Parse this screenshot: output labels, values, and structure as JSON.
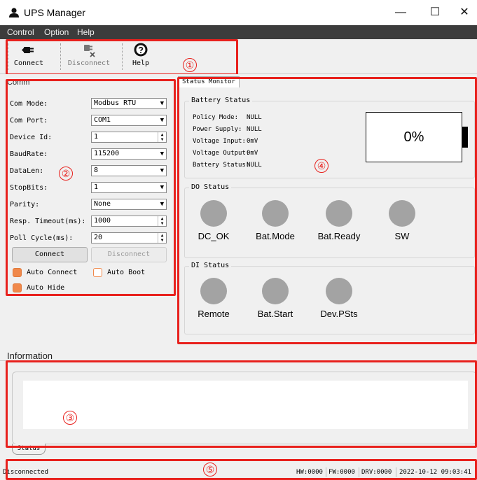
{
  "window": {
    "title": "UPS Manager",
    "minimize": "—",
    "maximize": "☐",
    "close": "✕"
  },
  "menu": [
    "Control",
    "Option",
    "Help"
  ],
  "toolbar": {
    "connect": "Connect",
    "disconnect": "Disconnect",
    "help": "Help"
  },
  "callouts": [
    "①",
    "②",
    "③",
    "④",
    "⑤"
  ],
  "comm": {
    "title": "Comm",
    "fields": [
      {
        "label": "Com Mode:",
        "value": "Modbus RTU",
        "control": "dropdown"
      },
      {
        "label": "Com Port:",
        "value": "COM1",
        "control": "dropdown"
      },
      {
        "label": "Device Id:",
        "value": "1",
        "control": "spinner"
      },
      {
        "label": "BaudRate:",
        "value": "115200",
        "control": "dropdown"
      },
      {
        "label": "DataLen:",
        "value": "8",
        "control": "dropdown"
      },
      {
        "label": "StopBits:",
        "value": "1",
        "control": "dropdown"
      },
      {
        "label": "Parity:",
        "value": "None",
        "control": "dropdown"
      },
      {
        "label": "Resp. Timeout(ms):",
        "value": "1000",
        "control": "spinner"
      },
      {
        "label": "Poll Cycle(ms):",
        "value": "20",
        "control": "spinner"
      }
    ],
    "connect_btn": "Connect",
    "disconnect_btn": "Disconnect",
    "auto_connect": {
      "label": "Auto Connect",
      "checked": true
    },
    "auto_boot": {
      "label": "Auto Boot",
      "checked": false
    },
    "auto_hide": {
      "label": "Auto Hide",
      "checked": true
    }
  },
  "status_monitor": {
    "tab": "Status Monitor",
    "battery_status": {
      "title": "Battery Status",
      "rows": [
        {
          "label": "Policy Mode:",
          "value": "NULL"
        },
        {
          "label": "Power Supply:",
          "value": "NULL"
        },
        {
          "label": "Voltage Input:",
          "value": "0mV"
        },
        {
          "label": "Voltage Output:",
          "value": "0mV"
        },
        {
          "label": "Battery Status:",
          "value": "NULL"
        }
      ],
      "percent": "0%"
    },
    "do_status": {
      "title": "DO Status",
      "leds": [
        "DC_OK",
        "Bat.Mode",
        "Bat.Ready",
        "SW"
      ]
    },
    "di_status": {
      "title": "DI Status",
      "leds": [
        "Remote",
        "Bat.Start",
        "Dev.PSts"
      ]
    },
    "led_color": "#a3a3a3"
  },
  "information": {
    "title": "Information",
    "tab": "Status"
  },
  "statusbar": {
    "connection": "Disconnected",
    "hw": "HW:0000",
    "fw": "FW:0000",
    "drv": "DRV:0000",
    "datetime": "2022-10-12 09:03:41"
  },
  "colors": {
    "annotation": "#e8211d",
    "checkbox": "#f0884a",
    "menubar": "#3c3c3c"
  }
}
